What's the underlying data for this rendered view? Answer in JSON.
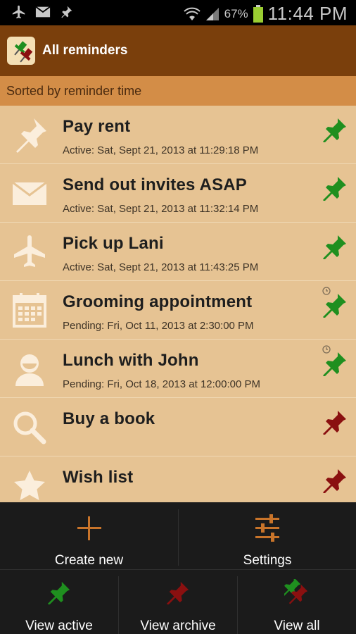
{
  "status_bar": {
    "battery_percent": "67%",
    "time": "11:44 PM",
    "icons": [
      "airplane-icon",
      "mail-icon",
      "pin-icon",
      "wifi-icon",
      "signal-icon",
      "battery-icon"
    ]
  },
  "app_bar": {
    "title": "All reminders"
  },
  "sort_bar": {
    "label": "Sorted by reminder time"
  },
  "reminders": [
    {
      "title": "Pay rent",
      "status": "Active: Sat, Sept 21, 2013 at 11:29:18 PM",
      "icon": "pushpin-icon",
      "pin_color": "green"
    },
    {
      "title": "Send out invites ASAP",
      "status": "Active: Sat, Sept 21, 2013 at 11:32:14 PM",
      "icon": "envelope-icon",
      "pin_color": "green"
    },
    {
      "title": "Pick up Lani",
      "status": "Active: Sat, Sept 21, 2013 at 11:43:25 PM",
      "icon": "airplane-icon",
      "pin_color": "green"
    },
    {
      "title": "Grooming appointment",
      "status": "Pending: Fri, Oct 11, 2013 at 2:30:00 PM",
      "icon": "calendar-icon",
      "pin_color": "green",
      "clock": true
    },
    {
      "title": "Lunch with John",
      "status": "Pending: Fri, Oct 18, 2013 at 12:00:00 PM",
      "icon": "person-icon",
      "pin_color": "green",
      "clock": true
    },
    {
      "title": "Buy a book",
      "status": "",
      "icon": "magnifier-icon",
      "pin_color": "red"
    },
    {
      "title": "Wish list",
      "status": "",
      "icon": "star-icon",
      "pin_color": "red"
    }
  ],
  "bottom_buttons": {
    "create_new": "Create new",
    "settings": "Settings",
    "view_active": "View active",
    "view_archive": "View archive",
    "view_all": "View all"
  },
  "colors": {
    "action_bar": "#7a3f0c",
    "sort_bar": "#d38d47",
    "list_bg": "#e6c393",
    "pin_green": "#1f8f1f",
    "pin_red": "#8a1010",
    "accent_orange": "#c8742a"
  }
}
